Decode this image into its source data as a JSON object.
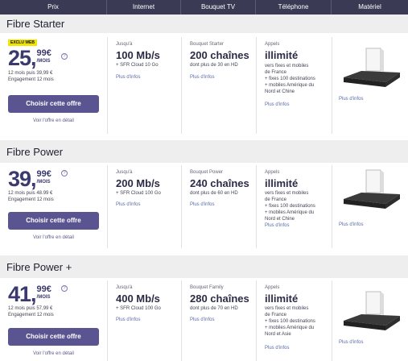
{
  "header": {
    "columns": [
      "Prix",
      "Internet",
      "Bouquet TV",
      "Téléphone",
      "Matériel"
    ]
  },
  "offers": [
    {
      "title": "Fibre Starter",
      "badge": "EXCLU WEB",
      "price_int": "25,",
      "price_dec": "99€",
      "price_unit": "/MOIS",
      "after_price": "12 mois puis 39,99 €",
      "engagement": "Engagement 12 mois",
      "cta": "Choisir cette offre",
      "detail_link": "Voir l'offre en détail",
      "internet_label": "Jusqu'à",
      "internet_speed": "100 Mb/s",
      "internet_extra": "+ SFR Cloud 10 Go",
      "internet_more": "Plus d'infos",
      "tv_label": "Bouquet Starter",
      "tv_channels": "200 chaînes",
      "tv_extra": "dont plus de 30 en HD",
      "tv_more": "Plus d'infos",
      "phone_label": "Appels",
      "phone_big": "illimité",
      "phone_lines": [
        "vers fixes et mobiles",
        "de France",
        "+ fixes 100 destinations",
        "+ mobiles Amérique du",
        "Nord et Chine"
      ],
      "phone_more": "Plus d'infos",
      "equip_more": "Plus d'infos"
    },
    {
      "title": "Fibre Power",
      "badge": "",
      "price_int": "39,",
      "price_dec": "99€",
      "price_unit": "/MOIS",
      "after_price": "12 mois puis 48.99 €",
      "engagement": "Engagement 12 mois",
      "cta": "Choisir cette offre",
      "detail_link": "Voir l'offre en détail",
      "internet_label": "Jusqu'à",
      "internet_speed": "200 Mb/s",
      "internet_extra": "+ SFR Cloud 100 Go",
      "internet_more": "Plus d'infos",
      "tv_label": "Bouquet Power",
      "tv_channels": "240 chaînes",
      "tv_extra": "dont plus de 60 en HD",
      "tv_more": "Plus d'infos",
      "phone_label": "Appels",
      "phone_big": "illimité",
      "phone_lines": [
        "vers fixes et mobiles",
        "de France",
        "+ fixes 100 destinations",
        "+ mobiles Amérique du",
        "Nord et Chine"
      ],
      "phone_more": "Plus d'infos",
      "equip_more": "Plus d'infos"
    },
    {
      "title": "Fibre Power +",
      "badge": "",
      "price_int": "41,",
      "price_dec": "99€",
      "price_unit": "/MOIS",
      "after_price": "12 mois puis 57,99 €",
      "engagement": "Engagement 12 mois",
      "cta": "Choisir cette offre",
      "detail_link": "Voir l'offre en détail",
      "internet_label": "Jusqu'à",
      "internet_speed": "400 Mb/s",
      "internet_extra": "+ SFR Cloud 100 Go",
      "internet_more": "Plus d'infos",
      "tv_label": "Bouquet Family",
      "tv_channels": "280 chaînes",
      "tv_extra": "dont plus de 70 en HD",
      "tv_more": "Plus d'infos",
      "phone_label": "Appels",
      "phone_big": "illimité",
      "phone_lines": [
        "vers fixes et mobiles",
        "de France",
        "+ fixes 100 destinations",
        "+ mobiles Amérique du",
        "Nord et Asie"
      ],
      "phone_more": "Plus d'infos",
      "equip_more": "Plus d'infos"
    }
  ],
  "colors": {
    "header_bg": "#3b3a55",
    "button_bg": "#5a5490",
    "price": "#3b3a6e",
    "badge": "#f1e400"
  }
}
